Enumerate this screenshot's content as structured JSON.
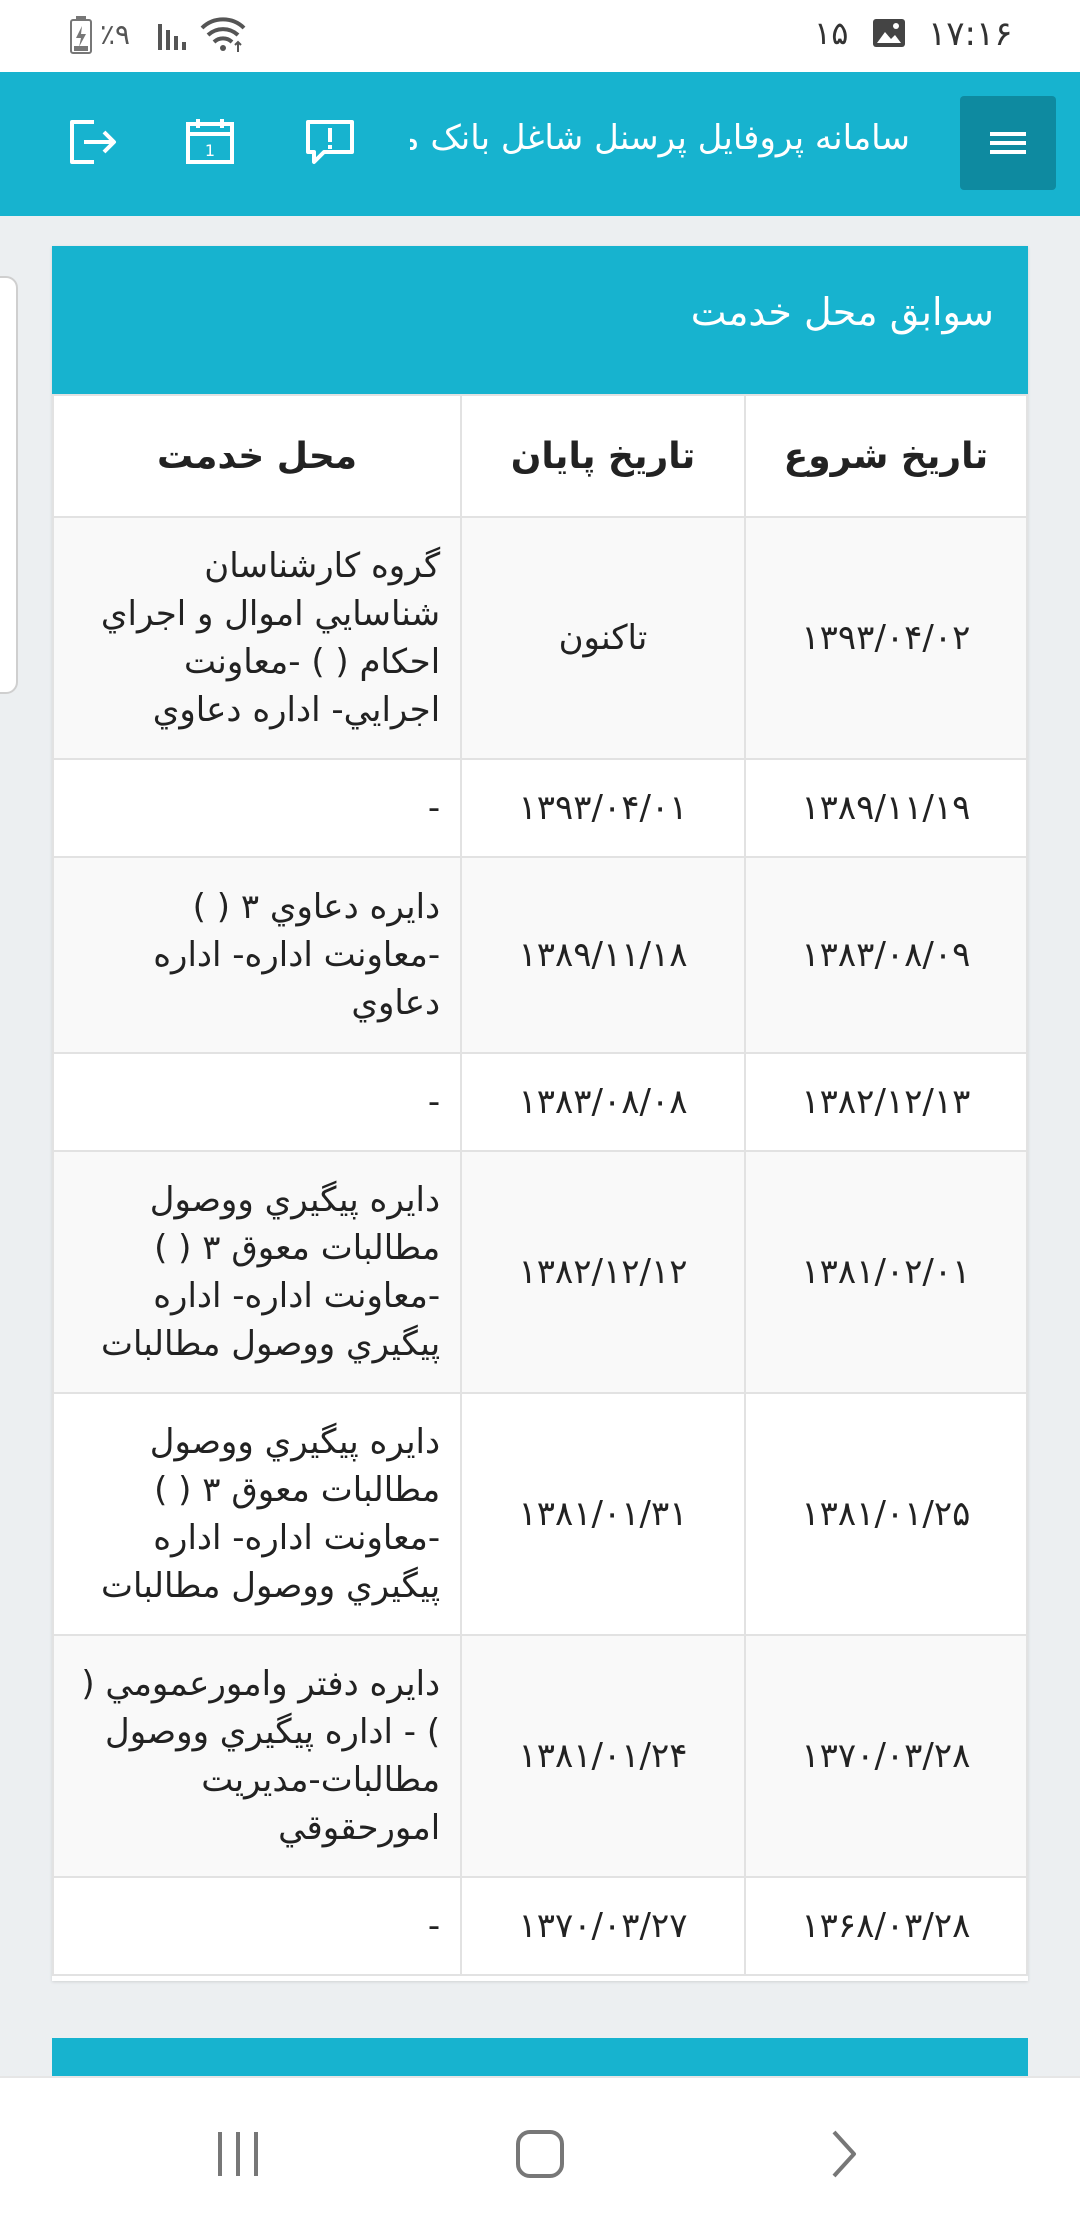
{
  "status_bar": {
    "time": "۱۷:۱۶",
    "notification_count": "۱۵",
    "battery": "٪۹"
  },
  "app_bar": {
    "title": "سامانه پروفایل پرسنل شاغل بانک ملی"
  },
  "card": {
    "title": "سوابق محل خدمت",
    "columns": {
      "start": "تاريخ شروع",
      "end": "تاريخ پايان",
      "place": "محل خدمت"
    },
    "rows": [
      {
        "start": "۱۳۹۳/۰۴/۰۲",
        "end": "تاکنون",
        "place": "گروه كارشناسان شناسايي اموال و اجراي احكام ( ) -معاونت اجرايي- اداره دعاوي"
      },
      {
        "start": "۱۳۸۹/۱۱/۱۹",
        "end": "۱۳۹۳/۰۴/۰۱",
        "place": "-"
      },
      {
        "start": "۱۳۸۳/۰۸/۰۹",
        "end": "۱۳۸۹/۱۱/۱۸",
        "place": "دايره دعاوي ۳ ( ) -معاونت اداره- اداره دعاوي"
      },
      {
        "start": "۱۳۸۲/۱۲/۱۳",
        "end": "۱۳۸۳/۰۸/۰۸",
        "place": "-"
      },
      {
        "start": "۱۳۸۱/۰۲/۰۱",
        "end": "۱۳۸۲/۱۲/۱۲",
        "place": "دايره پيگيري ووصول مطالبات معوق ۳ ( ) -معاونت اداره- اداره پيگيري ووصول مطالبات"
      },
      {
        "start": "۱۳۸۱/۰۱/۲۵",
        "end": "۱۳۸۱/۰۱/۳۱",
        "place": "دايره پيگيري ووصول مطالبات معوق ۳ ( ) -معاونت اداره- اداره پيگيري ووصول مطالبات"
      },
      {
        "start": "۱۳۷۰/۰۳/۲۸",
        "end": "۱۳۸۱/۰۱/۲۴",
        "place": "دايره دفتر وامورعمومي ( ) - اداره پيگيري ووصول مطالبات-مديريت امورحقوقي"
      },
      {
        "start": "۱۳۶۸/۰۳/۲۸",
        "end": "۱۳۷۰/۰۳/۲۷",
        "place": "-"
      }
    ]
  },
  "nav_bar": {
    "icons": [
      "recent-apps-icon",
      "home-icon",
      "back-icon"
    ]
  },
  "colors": {
    "primary": "#17b3cf",
    "primary_dark": "#0e8aa0",
    "page_bg": "#eceff1"
  }
}
